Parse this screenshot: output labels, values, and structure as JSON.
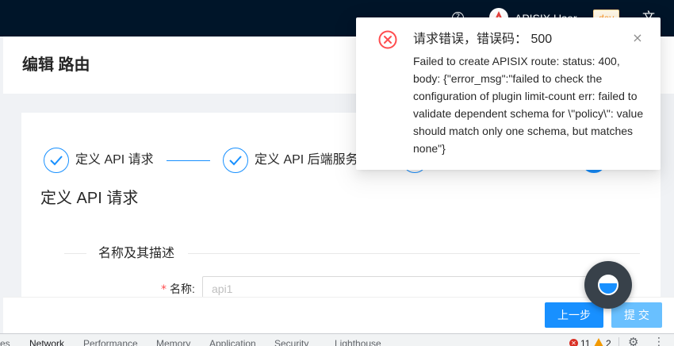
{
  "topbar": {
    "user_name": "APISIX User",
    "env_badge": "dev",
    "lang_toggle": "文",
    "help_glyph": "?"
  },
  "page": {
    "title": "编辑 路由"
  },
  "steps": [
    {
      "label": "定义 API 请求",
      "status": "finished"
    },
    {
      "label": "定义 API 后端服务",
      "status": "finished"
    },
    {
      "label": "",
      "status": "process"
    },
    {
      "label": "",
      "status": "process"
    }
  ],
  "section": {
    "title": "定义 API 请求",
    "divider": "名称及其描述"
  },
  "form": {
    "name_required_mark": "*",
    "name_label": "名称:",
    "name_placeholder": "api1"
  },
  "footer": {
    "prev_label": "上一步",
    "submit_label": "提 交"
  },
  "notification": {
    "title": "请求错误，错误码： 500",
    "description": "Failed to create APISIX route: status: 400, body: {\"error_msg\":\"failed to check the configuration of plugin limit-count err: failed to validate dependent schema for \\\"policy\\\": value should match only one schema, but matches none\"}",
    "close_glyph": "×",
    "icon": "close-circle-icon",
    "icon_color": "#ff4d4f"
  },
  "devtools": {
    "tabs": [
      "es",
      "Network",
      "Performance",
      "Memory",
      "Application",
      "Security",
      "Lighthouse"
    ],
    "active_tab": "Network",
    "error_count": "11",
    "warning_count": "2",
    "error_glyph": "✕",
    "gear_glyph": "⚙",
    "more_glyph": "⋮"
  },
  "colors": {
    "primary": "#1890ff",
    "header_bg": "#001529",
    "error": "#ff4d4f",
    "submit_disabled": "#69c0ff"
  }
}
